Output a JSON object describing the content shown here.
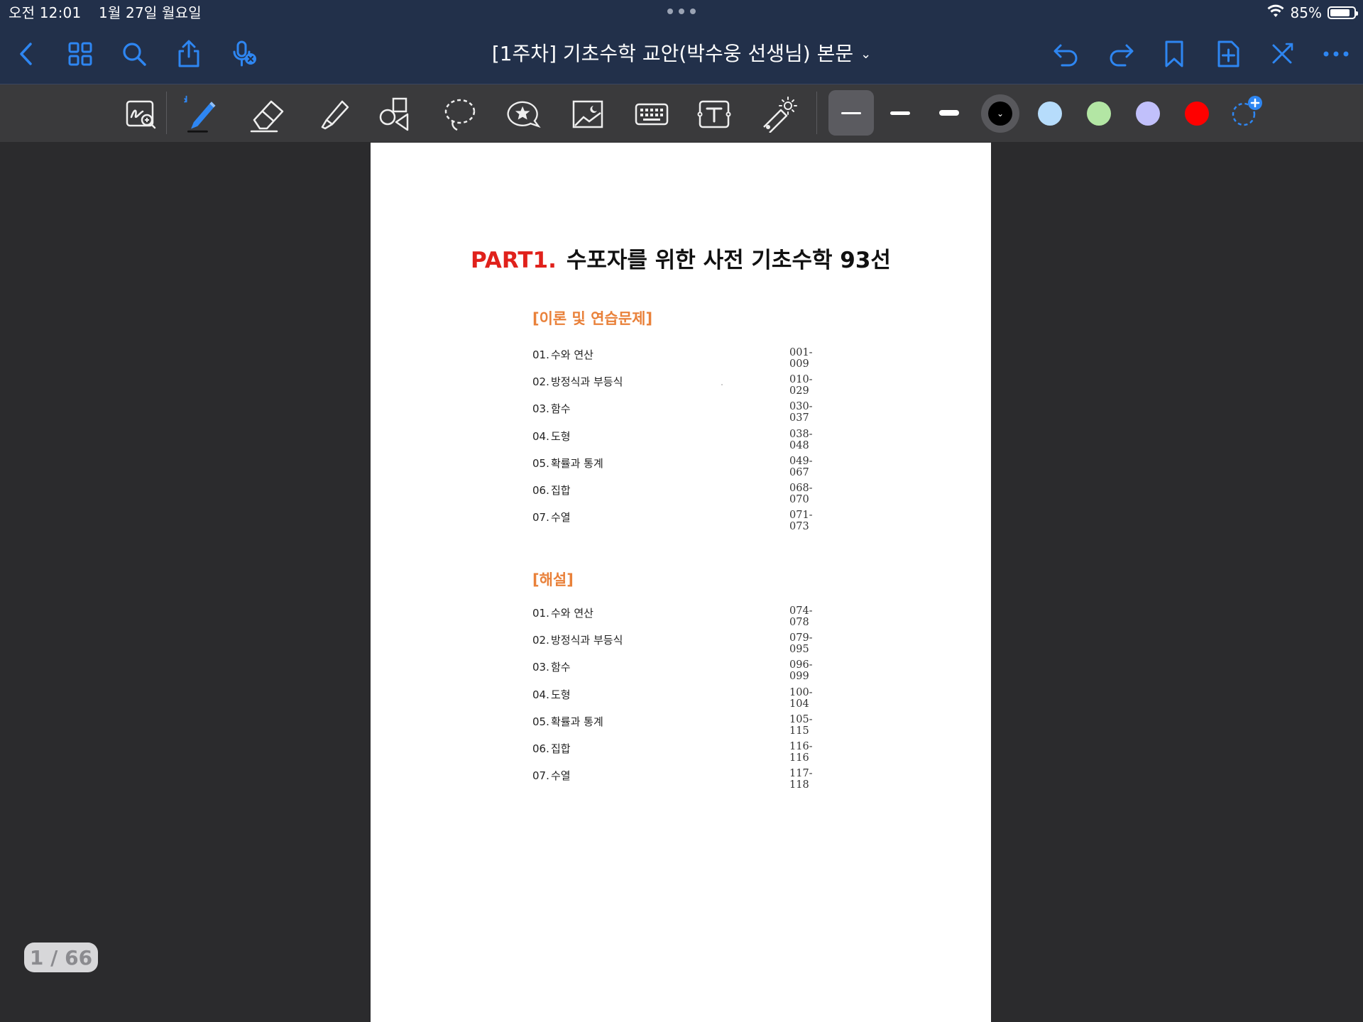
{
  "status_bar": {
    "time": "오전 12:01",
    "date": "1월 27일 월요일",
    "battery_text": "85%",
    "battery_level": 0.85
  },
  "header": {
    "title": "[1주차] 기초수학 교안(박수웅 선생님) 본문",
    "left_icons": [
      "back-chevron-icon",
      "grid-icon",
      "search-icon",
      "share-icon",
      "microphone-off-icon"
    ],
    "right_icons": [
      "undo-icon",
      "redo-icon",
      "bookmark-icon",
      "add-page-icon",
      "close-toolbar-icon",
      "more-icon"
    ],
    "accent_color": "#2e86f2"
  },
  "toolbar": {
    "tools": [
      "zoom-write-icon",
      "pen-icon",
      "eraser-icon",
      "highlighter-icon",
      "shapes-icon",
      "lasso-icon",
      "sticker-icon",
      "image-icon",
      "keyboard-icon",
      "text-box-icon",
      "laser-pointer-icon"
    ],
    "active_tool": "pen",
    "stroke_widths": [
      "thin",
      "medium",
      "thick"
    ],
    "selected_stroke": "thin",
    "colors": [
      "#000000",
      "#b6dcfb",
      "#b3e6a4",
      "#c1c0fb",
      "#ff0000"
    ],
    "selected_color": "#000000"
  },
  "document": {
    "part_label": "PART1.",
    "part_title": "수포자를 위한 사전 기초수학 93선",
    "sections": [
      {
        "title": "[이론 및 연습문제]",
        "items": [
          {
            "num": "01.",
            "name": "수와 연산",
            "range": "001-009"
          },
          {
            "num": "02.",
            "name": "방정식과 부등식",
            "range": "010-029"
          },
          {
            "num": "03.",
            "name": "함수",
            "range": "030-037"
          },
          {
            "num": "04.",
            "name": "도형",
            "range": "038-048"
          },
          {
            "num": "05.",
            "name": "확률과 통계",
            "range": "049-067"
          },
          {
            "num": "06.",
            "name": "집합",
            "range": "068-070"
          },
          {
            "num": "07.",
            "name": "수열",
            "range": "071-073"
          }
        ]
      },
      {
        "title": "[해설]",
        "items": [
          {
            "num": "01.",
            "name": "수와 연산",
            "range": "074-078"
          },
          {
            "num": "02.",
            "name": "방정식과 부등식",
            "range": "079-095"
          },
          {
            "num": "03.",
            "name": "함수",
            "range": "096-099"
          },
          {
            "num": "04.",
            "name": "도형",
            "range": "100-104"
          },
          {
            "num": "05.",
            "name": "확률과 통계",
            "range": "105-115"
          },
          {
            "num": "06.",
            "name": "집합",
            "range": "116-116"
          },
          {
            "num": "07.",
            "name": "수열",
            "range": "117-118"
          }
        ]
      }
    ]
  },
  "page_indicator": "1 / 66"
}
